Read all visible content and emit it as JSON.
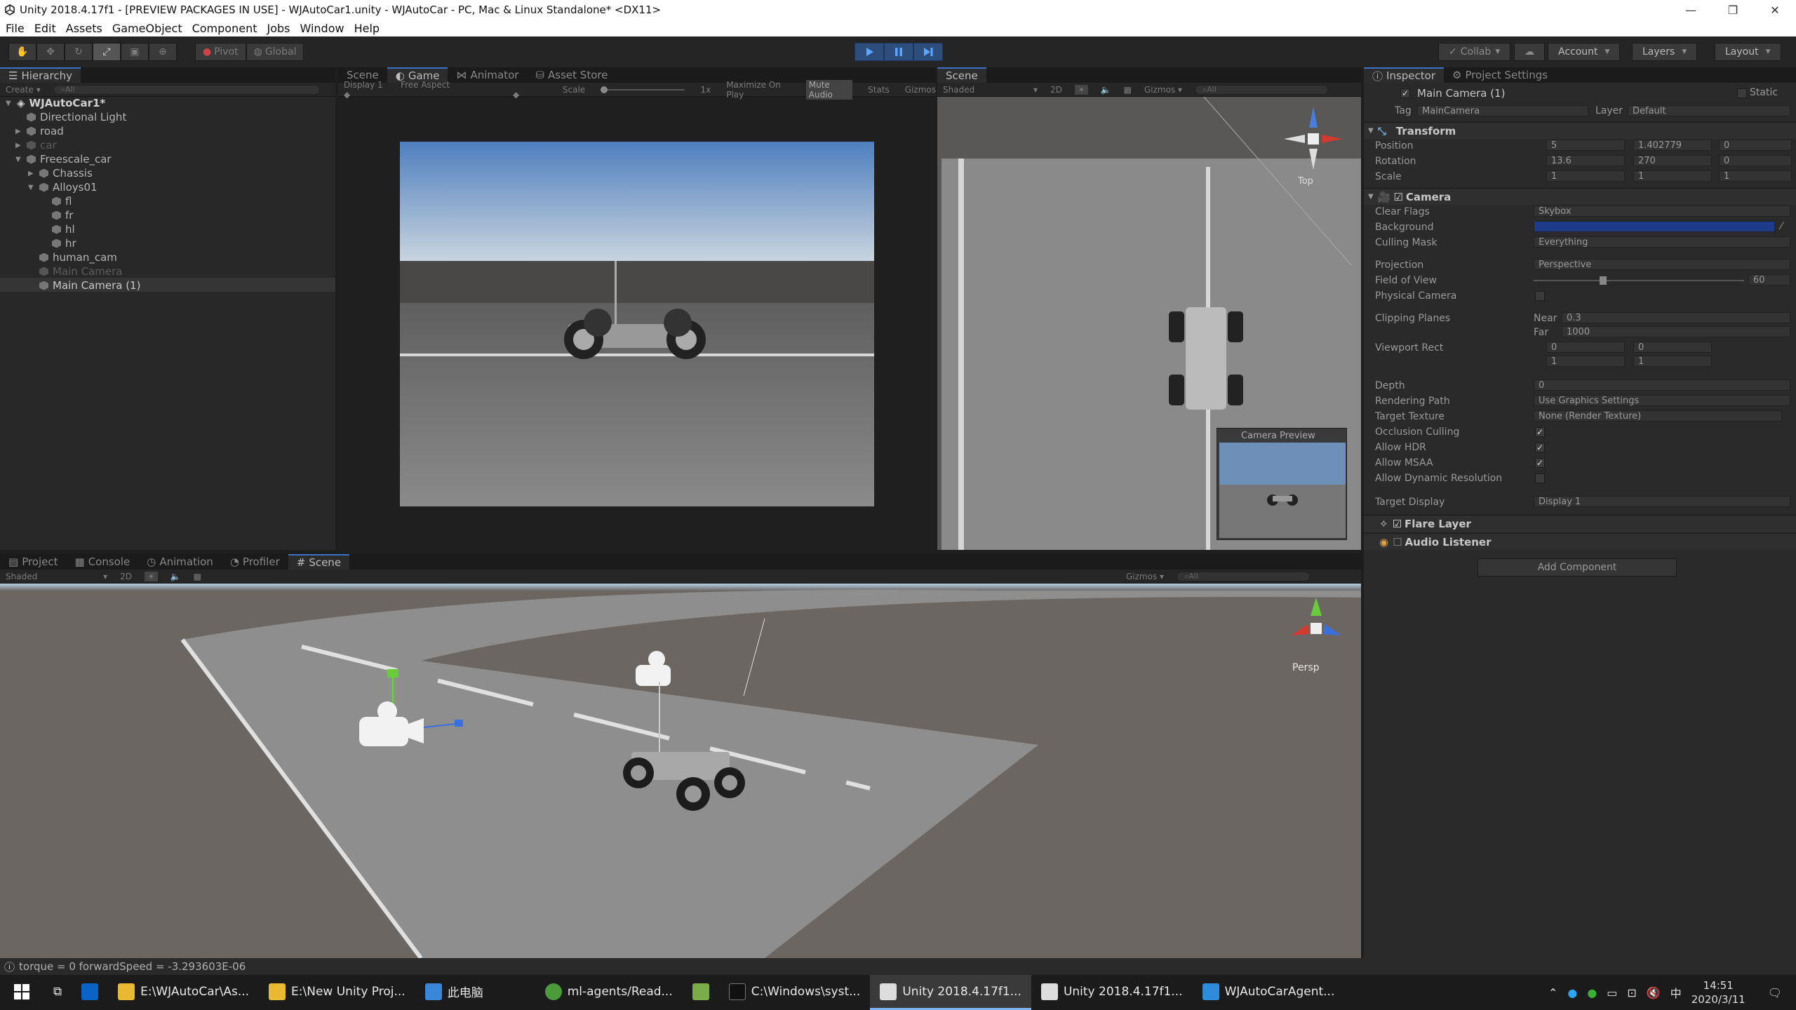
{
  "window": {
    "title": "Unity 2018.4.17f1 - [PREVIEW PACKAGES IN USE] - WJAutoCar1.unity - WJAutoCar - PC, Mac & Linux Standalone* <DX11>"
  },
  "menu": [
    "File",
    "Edit",
    "Assets",
    "GameObject",
    "Component",
    "Jobs",
    "Window",
    "Help"
  ],
  "toolbar": {
    "pivot": "Pivot",
    "global": "Global",
    "collab": "Collab",
    "account": "Account",
    "layers": "Layers",
    "layout": "Layout"
  },
  "hierarchy": {
    "tab": "Hierarchy",
    "create": "Create",
    "search_placeholder": "All",
    "scene": "WJAutoCar1*",
    "items": [
      "Directional Light",
      "road",
      "car",
      "Freescale_car",
      "Chassis",
      "Alloys01",
      "fl",
      "fr",
      "hl",
      "hr",
      "human_cam",
      "Main Camera",
      "Main Camera (1)"
    ]
  },
  "game": {
    "tabs": [
      "Scene",
      "Game",
      "Animator",
      "Asset Store"
    ],
    "display": "Display 1",
    "aspect": "Free Aspect",
    "scale_label": "Scale",
    "scale_value": "1x",
    "buttons": [
      "Maximize On Play",
      "Mute Audio",
      "Stats",
      "Gizmos"
    ]
  },
  "scene_top": {
    "tab": "Scene",
    "shaded": "Shaded",
    "mode2d": "2D",
    "gizmos": "Gizmos",
    "search": "All",
    "view_label": "Top",
    "camera_preview": "Camera Preview"
  },
  "bottom": {
    "tabs": [
      "Project",
      "Console",
      "Animation",
      "Profiler",
      "Scene"
    ],
    "shaded": "Shaded",
    "mode2d": "2D",
    "gizmos": "Gizmos",
    "search": "All",
    "persp": "Persp"
  },
  "inspector": {
    "tabs": [
      "Inspector",
      "Project Settings"
    ],
    "object_name": "Main Camera (1)",
    "static": "Static",
    "tag_label": "Tag",
    "tag_value": "MainCamera",
    "layer_label": "Layer",
    "layer_value": "Default",
    "transform": {
      "title": "Transform",
      "position_label": "Position",
      "position": [
        "5",
        "1.402779",
        "0"
      ],
      "rotation_label": "Rotation",
      "rotation": [
        "13.6",
        "270",
        "0"
      ],
      "scale_label": "Scale",
      "scale": [
        "1",
        "1",
        "1"
      ]
    },
    "camera": {
      "title": "Camera",
      "clear_flags_label": "Clear Flags",
      "clear_flags": "Skybox",
      "background_label": "Background",
      "background_color": "#1e3a8a",
      "culling_label": "Culling Mask",
      "culling": "Everything",
      "projection_label": "Projection",
      "projection": "Perspective",
      "fov_label": "Field of View",
      "fov": "60",
      "physical_label": "Physical Camera",
      "clipping_label": "Clipping Planes",
      "near_label": "Near",
      "near": "0.3",
      "far_label": "Far",
      "far": "1000",
      "viewport_label": "Viewport Rect",
      "viewport": [
        "0",
        "0",
        "1",
        "1"
      ],
      "depth_label": "Depth",
      "depth": "0",
      "rendering_label": "Rendering Path",
      "rendering": "Use Graphics Settings",
      "target_texture_label": "Target Texture",
      "target_texture": "None (Render Texture)",
      "occlusion_label": "Occlusion Culling",
      "hdr_label": "Allow HDR",
      "msaa_label": "Allow MSAA",
      "dynres_label": "Allow Dynamic Resolution",
      "target_display_label": "Target Display",
      "target_display": "Display 1"
    },
    "flare": "Flare Layer",
    "audio": "Audio Listener",
    "add_component": "Add Component"
  },
  "status": "torque = 0 forwardSpeed = -3.293603E-06",
  "taskbar": {
    "items": [
      "E:\\WJAutoCar\\As...",
      "E:\\New Unity Proj...",
      "此电脑",
      "ml-agents/Read...",
      "C:\\Windows\\syst...",
      "Unity 2018.4.17f1...",
      "Unity 2018.4.17f1...",
      "WJAutoCarAgent..."
    ],
    "time": "14:51",
    "date": "2020/3/11",
    "ime": "中"
  }
}
